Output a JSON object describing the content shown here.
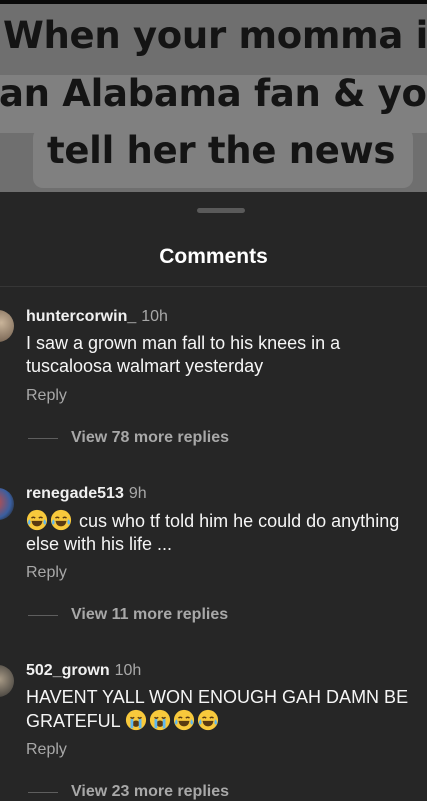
{
  "post": {
    "caption_lines": [
      "When your momma is",
      "an Alabama fan & you",
      "tell her the news"
    ]
  },
  "sheet": {
    "title": "Comments"
  },
  "comments": [
    {
      "username": "huntercorwin_",
      "time": "10h",
      "text": "I saw a grown man fall to his knees in a tuscaloosa walmart yesterday",
      "reply_label": "Reply",
      "more_replies": "View 78 more replies",
      "emoji_prefix": []
    },
    {
      "username": "renegade513",
      "time": "9h",
      "text": "cus who tf told him he could do anything else with his life ...",
      "reply_label": "Reply",
      "more_replies": "View 11 more replies",
      "emoji_prefix": [
        "laughing-tears-emoji",
        "laughing-tears-emoji"
      ]
    },
    {
      "username": "502_grown",
      "time": "10h",
      "text": "HAVENT YALL WON ENOUGH GAH DAMN BE GRATEFUL",
      "reply_label": "Reply",
      "more_replies": "View 23 more replies",
      "emoji_suffix": [
        "loudly-crying-emoji",
        "loudly-crying-emoji",
        "laughing-tears-emoji",
        "laughing-tears-emoji"
      ]
    }
  ],
  "colors": {
    "sheet_background": "#262626",
    "secondary_text": "#a8a8a8",
    "primary_text": "#f5f5f5"
  }
}
